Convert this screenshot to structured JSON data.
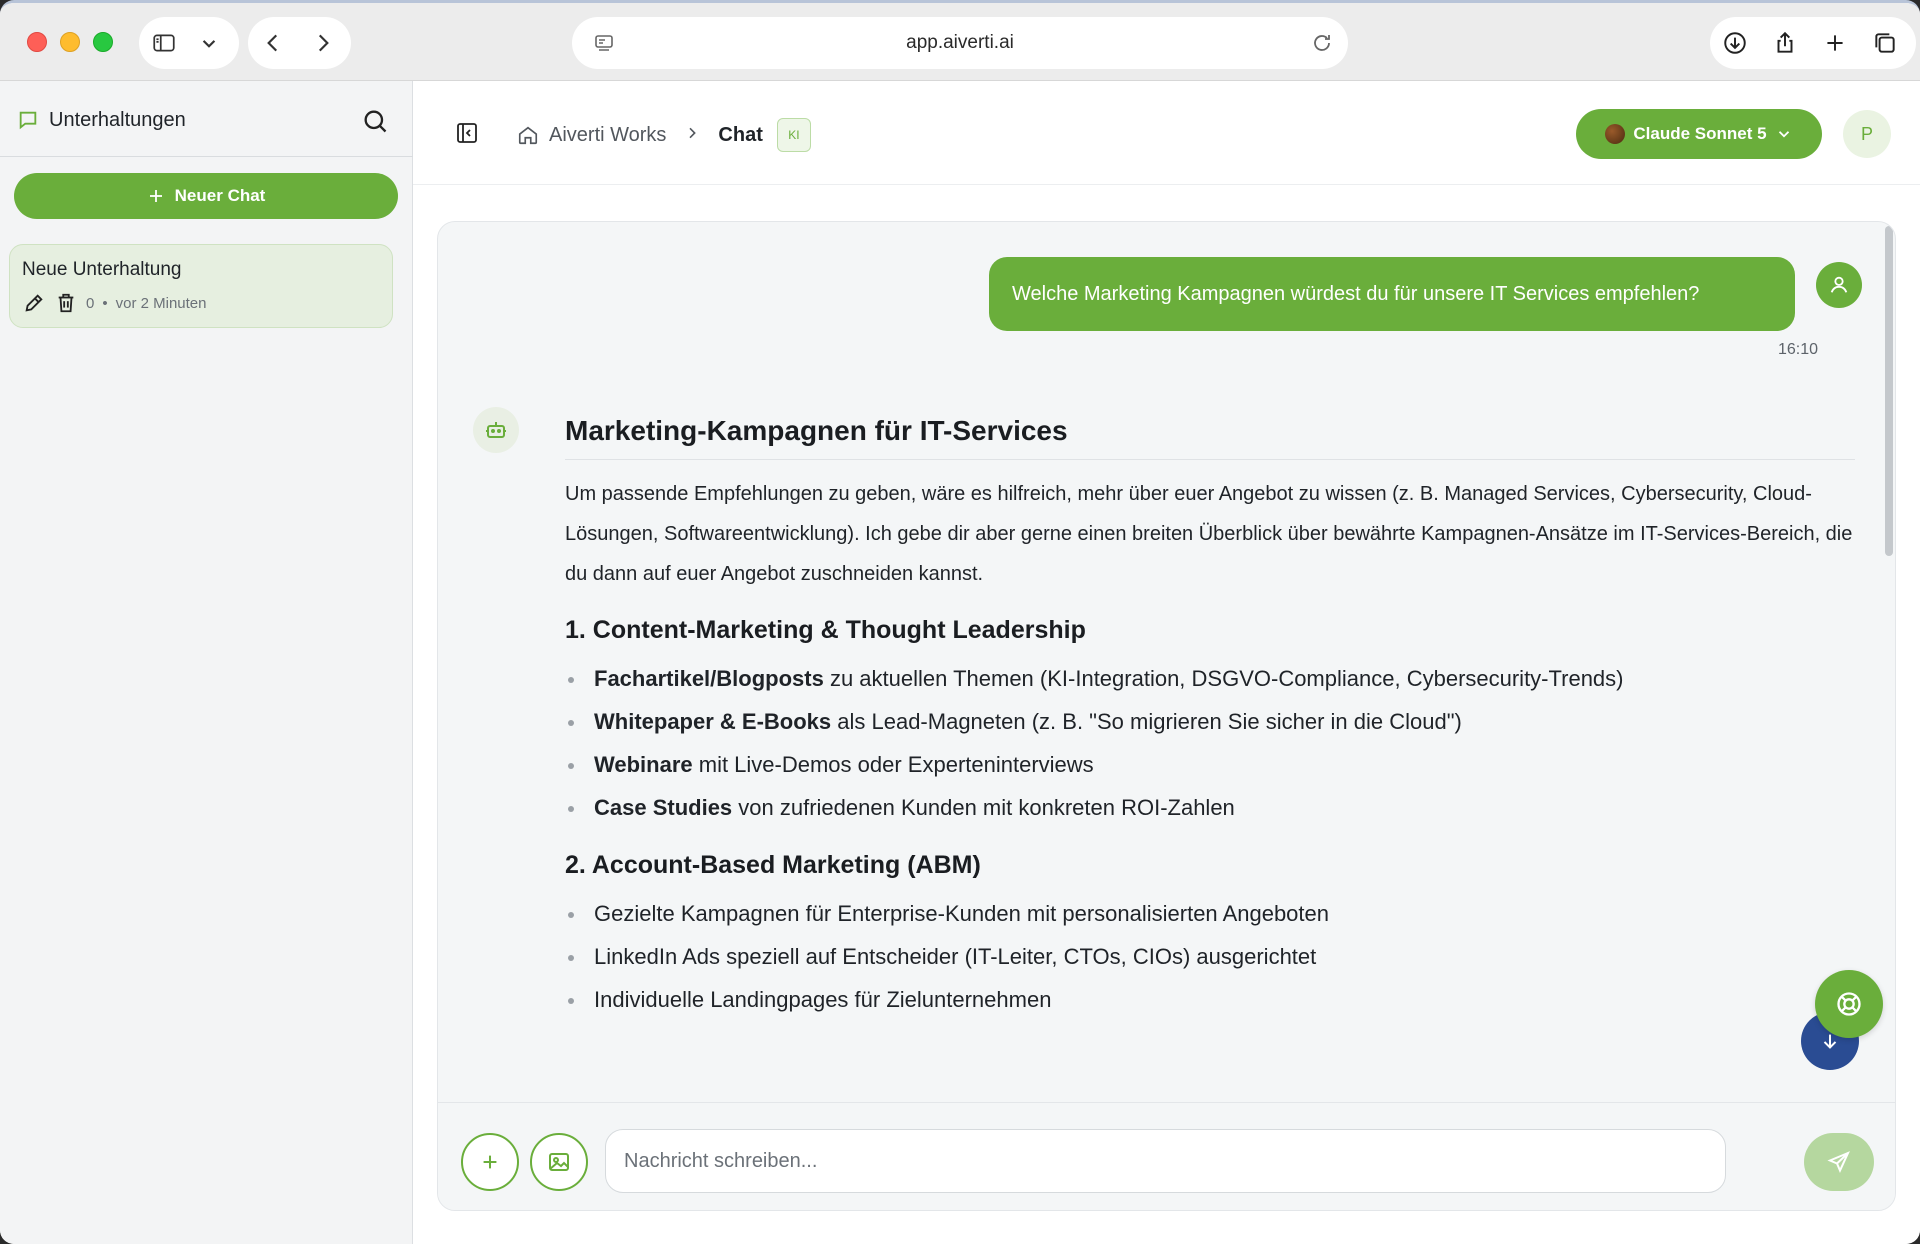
{
  "browser": {
    "url": "app.aiverti.ai"
  },
  "sidebar": {
    "title": "Unterhaltungen",
    "new_chat_label": "Neuer Chat",
    "conversations": [
      {
        "title": "Neue Unterhaltung",
        "message_count": "0",
        "separator": "•",
        "time": "vor 2 Minuten"
      }
    ]
  },
  "header": {
    "breadcrumb_home": "Aiverti Works",
    "breadcrumb_current": "Chat",
    "badge": "KI",
    "model_label": "Claude Sonnet 5",
    "user_initial": "P"
  },
  "chat": {
    "user_message": "Welche Marketing Kampagnen würdest du für unsere IT Services empfehlen?",
    "user_message_time": "16:10",
    "answer": {
      "title": "Marketing-Kampagnen für IT-Services",
      "intro": "Um passende Empfehlungen zu geben, wäre es hilfreich, mehr über euer Angebot zu wissen (z. B. Managed Services, Cybersecurity, Cloud-Lösungen, Softwareentwicklung). Ich gebe dir aber gerne einen breiten Überblick über bewährte Kampagnen-Ansätze im IT-Services-Bereich, die du dann auf euer Angebot zuschneiden kannst.",
      "sections": [
        {
          "heading": "1. Content-Marketing & Thought Leadership",
          "items": [
            {
              "bold": "Fachartikel/Blogposts",
              "text": " zu aktuellen Themen (KI-Integration, DSGVO-Compliance, Cybersecurity-Trends)"
            },
            {
              "bold": "Whitepaper & E-Books",
              "text": " als Lead-Magneten (z. B. \"So migrieren Sie sicher in die Cloud\")"
            },
            {
              "bold": "Webinare",
              "text": " mit Live-Demos oder Experteninterviews"
            },
            {
              "bold": "Case Studies",
              "text": " von zufriedenen Kunden mit konkreten ROI-Zahlen"
            }
          ]
        },
        {
          "heading": "2. Account-Based Marketing (ABM)",
          "items": [
            {
              "bold": "",
              "text": "Gezielte Kampagnen für Enterprise-Kunden mit personalisierten Angeboten"
            },
            {
              "bold": "",
              "text": "LinkedIn Ads speziell auf Entscheider (IT-Leiter, CTOs, CIOs) ausgerichtet"
            },
            {
              "bold": "",
              "text": "Individuelle Landingpages für Zielunternehmen"
            }
          ]
        }
      ]
    }
  },
  "composer": {
    "placeholder": "Nachricht schreiben...",
    "value": ""
  },
  "colors": {
    "accent": "#6aae3b",
    "accent_light": "#b5d79f",
    "scroll_button": "#2a4c93"
  }
}
